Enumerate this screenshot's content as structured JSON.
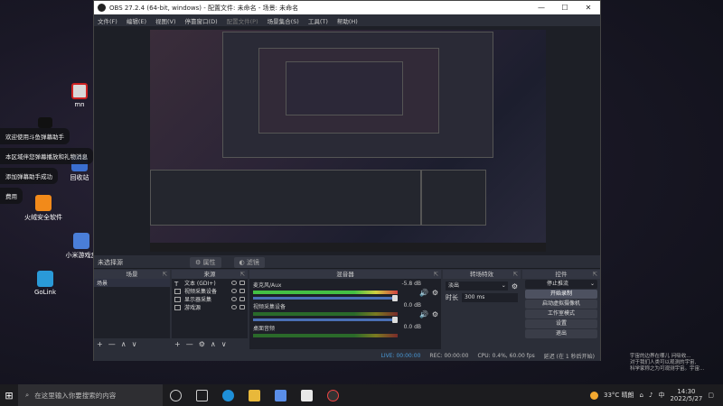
{
  "desktop": {
    "icons": [
      {
        "label": "mn"
      },
      {
        "label": "回收站"
      },
      {
        "label": "火绒安全软件"
      },
      {
        "label": "小米游戏盒"
      },
      {
        "label": "GoLink"
      }
    ],
    "toasts": [
      "欢迎使用斗鱼弹幕助手",
      "本区域伴您弹幕播放和礼物消息",
      "添加弹幕助手成功",
      "费用"
    ],
    "notification": [
      "宇宙的边界在哪儿 问吸收...",
      "对于我们人类可以观测的宇宙,",
      "科学家称之为可观测宇宙。宇宙..."
    ]
  },
  "window": {
    "title": "OBS 27.2.4 (64-bit, windows) - 配置文件: 未命名 - 场景: 未命名",
    "controls": [
      "—",
      "☐",
      "✕"
    ],
    "menu": [
      "文件(F)",
      "编辑(E)",
      "视图(V)",
      "停靠窗口(D)",
      "配置文件(P)",
      "场景集合(S)",
      "工具(T)",
      "帮助(H)"
    ]
  },
  "scene_bar": {
    "label": "未选择源",
    "properties": "属性",
    "filters": "滤镜"
  },
  "docks": {
    "scenes": {
      "title": "场景",
      "items": [
        "场景"
      ]
    },
    "sources": {
      "title": "来源",
      "items": [
        "文本 (GDI+)",
        "视频采集设备",
        "显示器采集",
        "游戏源"
      ]
    },
    "mixer": {
      "title": "混音器",
      "tracks": [
        {
          "name": "麦克风/Aux",
          "db": "-5.8 dB"
        },
        {
          "name": "视频采集设备",
          "db": "0.0 dB"
        },
        {
          "name": "桌面音频",
          "db": "0.0 dB"
        }
      ]
    },
    "transitions": {
      "title": "转场特效",
      "type": "淡出",
      "duration_label": "时长",
      "duration": "300 ms"
    },
    "controls": {
      "title": "控件",
      "buttons": [
        "停止推流",
        "开始录制",
        "启动虚拟摄像机",
        "工作室模式",
        "设置",
        "退出"
      ]
    }
  },
  "status": {
    "live": "LIVE: 00:00:00",
    "rec": "REC: 00:00:00",
    "cpu": "CPU: 0.4%, 60.00 fps",
    "delay": "延迟 (在 1 秒后开始)"
  },
  "taskbar": {
    "search_placeholder": "在这里输入你要搜索的内容",
    "weather": "33°C  晴朗",
    "time": "14:30",
    "date": "2022/5/27",
    "lang": "中"
  },
  "colors": {
    "obs_bg": "#2b2e38",
    "dock_body": "#1e2028",
    "fader": "#4a6fb5",
    "meter_green": "#44c044"
  }
}
